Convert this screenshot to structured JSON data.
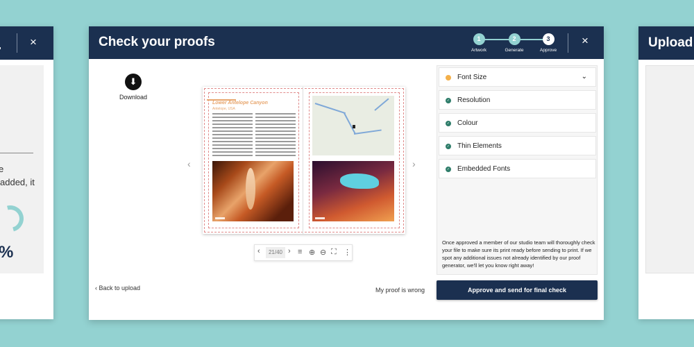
{
  "left_card": {
    "line1": "e",
    "line2": "added, it",
    "percent": "%"
  },
  "right_card": {
    "title": "Upload A"
  },
  "header": {
    "title": "Check your proofs",
    "steps": [
      {
        "number": "1",
        "label": "Artwork",
        "state": "done"
      },
      {
        "number": "2",
        "label": "Generate",
        "state": "done"
      },
      {
        "number": "3",
        "label": "Approve",
        "state": "current"
      }
    ],
    "close_icon": "×"
  },
  "download": {
    "icon": "⬇",
    "label": "Download"
  },
  "nav": {
    "prev": "‹",
    "next": "›"
  },
  "proof": {
    "article_title": "Lower Antelope Canyon",
    "article_subtitle": "Antelope, USA"
  },
  "viewer_toolbar": {
    "prev": "‹",
    "page_counter": "21/40",
    "next": "›",
    "menu_icon": "≡",
    "zoom_in_icon": "⊕",
    "zoom_out_icon": "⊖",
    "fullscreen_icon": "⛶",
    "more_icon": "⋮"
  },
  "checks": {
    "items": [
      {
        "label": "Font Size",
        "status": "warning",
        "expanded": true
      },
      {
        "label": "Resolution",
        "status": "ok"
      },
      {
        "label": "Colour",
        "status": "ok"
      },
      {
        "label": "Thin Elements",
        "status": "ok"
      },
      {
        "label": "Embedded Fonts",
        "status": "ok"
      }
    ],
    "note": "Once approved a member of our studio team will thoroughly check your file to make sure its print ready before sending to print. If we spot any additional issues not already identified by our proof generator, we'll let you know right away!"
  },
  "footer": {
    "back_label": "Back to upload",
    "wrong_label": "My proof is wrong",
    "approve_label": "Approve and send for final check"
  },
  "colors": {
    "background": "#93d2d1",
    "header": "#1b3050",
    "accent": "#93d2d1",
    "ok": "#2f7d6a",
    "warning": "#f4b04a"
  }
}
